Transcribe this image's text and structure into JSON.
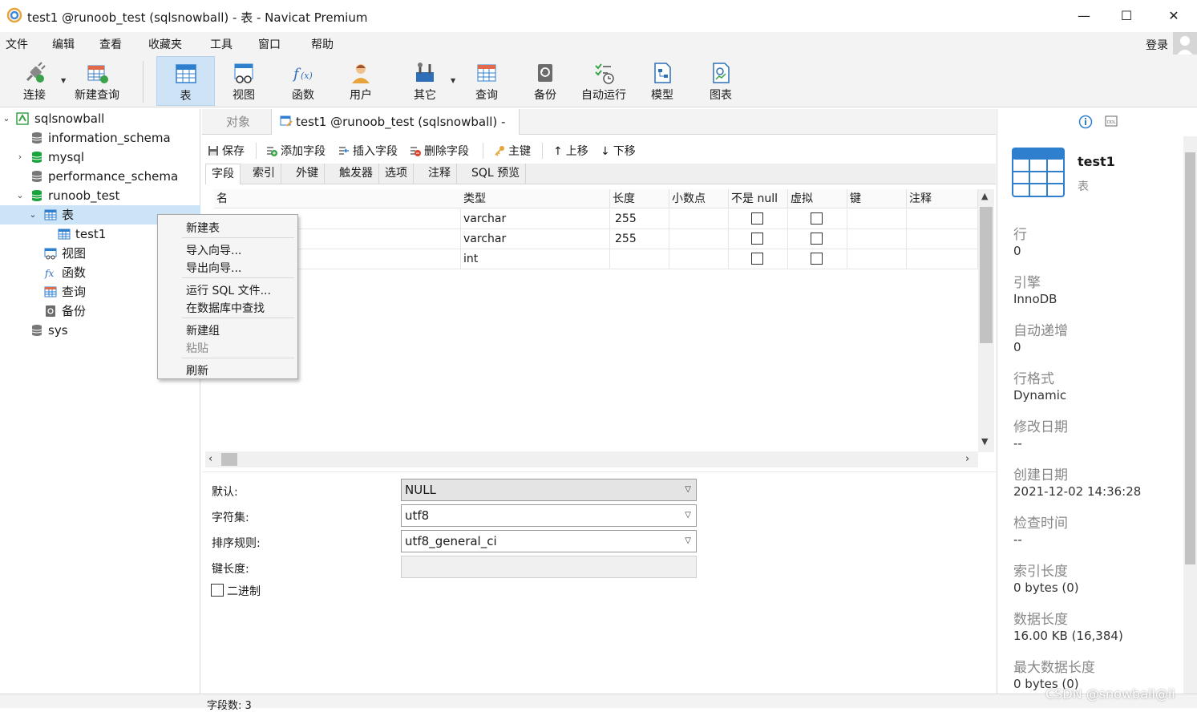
{
  "window": {
    "title": "test1 @runoob_test (sqlsnowball) - 表 - Navicat Premium",
    "minimize": "—",
    "maximize": "☐",
    "close": "✕"
  },
  "menubar": {
    "items": [
      "文件",
      "编辑",
      "查看",
      "收藏夹",
      "工具",
      "窗口",
      "帮助"
    ],
    "login": "登录"
  },
  "toolbar": {
    "buttons": [
      {
        "label": "连接",
        "icon": "connection-icon"
      },
      {
        "label": "新建查询",
        "icon": "new-query-icon"
      },
      {
        "label": "表",
        "icon": "table-icon"
      },
      {
        "label": "视图",
        "icon": "view-icon"
      },
      {
        "label": "函数",
        "icon": "function-icon"
      },
      {
        "label": "用户",
        "icon": "user-icon"
      },
      {
        "label": "其它",
        "icon": "tools-icon"
      },
      {
        "label": "查询",
        "icon": "query-icon"
      },
      {
        "label": "备份",
        "icon": "backup-icon"
      },
      {
        "label": "自动运行",
        "icon": "autorun-icon"
      },
      {
        "label": "模型",
        "icon": "model-icon"
      },
      {
        "label": "图表",
        "icon": "chart-icon"
      }
    ],
    "active": "表"
  },
  "tree": {
    "items": [
      {
        "label": "sqlsnowball",
        "level": 0,
        "twisty": "expanded",
        "icon": "connection-icon"
      },
      {
        "label": "information_schema",
        "level": 1,
        "twisty": "none",
        "icon": "database-grey-icon"
      },
      {
        "label": "mysql",
        "level": 1,
        "twisty": "collapsed",
        "icon": "database-green-icon"
      },
      {
        "label": "performance_schema",
        "level": 1,
        "twisty": "none",
        "icon": "database-grey-icon"
      },
      {
        "label": "runoob_test",
        "level": 1,
        "twisty": "expanded",
        "icon": "database-green-icon"
      },
      {
        "label": "表",
        "level": 2,
        "twisty": "expanded",
        "icon": "table-icon",
        "selected": true
      },
      {
        "label": "test1",
        "level": 3,
        "twisty": "none",
        "icon": "table-icon"
      },
      {
        "label": "视图",
        "level": 2,
        "twisty": "none",
        "icon": "view-icon"
      },
      {
        "label": "函数",
        "level": 2,
        "twisty": "none",
        "icon": "function-icon"
      },
      {
        "label": "查询",
        "level": 2,
        "twisty": "none",
        "icon": "query-icon"
      },
      {
        "label": "备份",
        "level": 2,
        "twisty": "none",
        "icon": "backup-icon"
      },
      {
        "label": "sys",
        "level": 1,
        "twisty": "none",
        "icon": "database-grey-icon"
      }
    ]
  },
  "context_menu": {
    "items": [
      {
        "label": "新建表",
        "disabled": false
      },
      {
        "label": "导入向导...",
        "disabled": false
      },
      {
        "label": "导出向导...",
        "disabled": false
      },
      {
        "label": "运行 SQL 文件...",
        "disabled": false
      },
      {
        "label": "在数据库中查找",
        "disabled": false
      },
      {
        "label": "新建组",
        "disabled": false
      },
      {
        "label": "粘贴",
        "disabled": true
      },
      {
        "label": "刷新",
        "disabled": false
      }
    ]
  },
  "object_tabs": {
    "objects": "对象",
    "current": "test1 @runoob_test (sqlsnowball) - 表"
  },
  "edit_toolbar": {
    "save": "保存",
    "add_field": "添加字段",
    "insert_field": "插入字段",
    "delete_field": "删除字段",
    "primary_key": "主键",
    "move_up": "上移",
    "move_down": "下移"
  },
  "sub_tabs": [
    "字段",
    "索引",
    "外键",
    "触发器",
    "选项",
    "注释",
    "SQL 预览"
  ],
  "grid": {
    "columns": [
      "名",
      "类型",
      "长度",
      "小数点",
      "不是 null",
      "虚拟",
      "键",
      "注释"
    ],
    "rows": [
      {
        "type": "varchar",
        "length": "255"
      },
      {
        "type": "varchar",
        "length": "255"
      },
      {
        "type": "int",
        "length": ""
      }
    ]
  },
  "properties": {
    "default_label": "默认:",
    "default_value": "NULL",
    "charset_label": "字符集:",
    "charset_value": "utf8",
    "collation_label": "排序规则:",
    "collation_value": "utf8_general_ci",
    "keylen_label": "键长度:",
    "binary_label": "二进制"
  },
  "status": {
    "field_count": "字段数: 3"
  },
  "info": {
    "name": "test1",
    "type": "表",
    "fields": [
      {
        "label": "行",
        "value": "0"
      },
      {
        "label": "引擎",
        "value": "InnoDB"
      },
      {
        "label": "自动递增",
        "value": "0"
      },
      {
        "label": "行格式",
        "value": "Dynamic"
      },
      {
        "label": "修改日期",
        "value": "--"
      },
      {
        "label": "创建日期",
        "value": "2021-12-02 14:36:28"
      },
      {
        "label": "检查时间",
        "value": "--"
      },
      {
        "label": "索引长度",
        "value": "0 bytes (0)"
      },
      {
        "label": "数据长度",
        "value": "16.00 KB (16,384)"
      },
      {
        "label": "最大数据长度",
        "value": "0 bytes (0)"
      }
    ]
  },
  "watermark": "CSDN @snowball@li",
  "colors": {
    "accent": "#2f7fcf",
    "selection": "#cce4f7",
    "db_green": "#1aa33b"
  }
}
